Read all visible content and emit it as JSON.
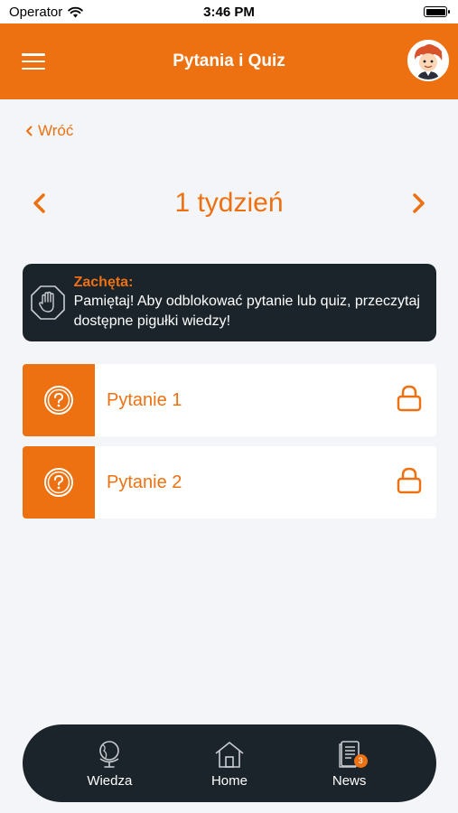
{
  "status_bar": {
    "carrier": "Operator",
    "time": "3:46 PM"
  },
  "header": {
    "title": "Pytania i Quiz",
    "menu_icon": "hamburger-menu-icon",
    "avatar_icon": "cartoon-avatar-icon"
  },
  "back": {
    "label": "Wróć"
  },
  "week": {
    "title": "1 tydzień"
  },
  "hint": {
    "title": "Zachęta:",
    "body": "Pamiętaj! Aby odblokować pytanie lub quiz, przeczytaj dostępne pigułki wiedzy!",
    "icon": "stop-hand-icon"
  },
  "questions": [
    {
      "label": "Pytanie 1",
      "locked": true
    },
    {
      "label": "Pytanie 2",
      "locked": true
    }
  ],
  "bottom_nav": {
    "items": [
      {
        "label": "Wiedza",
        "icon": "globe-icon"
      },
      {
        "label": "Home",
        "icon": "home-icon"
      },
      {
        "label": "News",
        "icon": "news-icon",
        "badge": "3"
      }
    ]
  },
  "colors": {
    "accent": "#ee7111",
    "dark": "#1b242b",
    "background": "#f3f5f9"
  }
}
